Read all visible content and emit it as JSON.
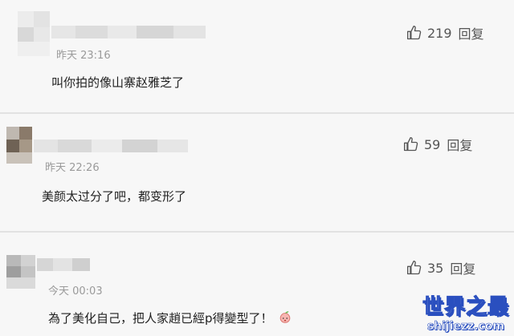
{
  "comments": [
    {
      "time": "昨天 23:16",
      "text": "叫你拍的像山寨赵雅芝了",
      "likes": "219",
      "reply_label": "回复"
    },
    {
      "time": "昨天 22:26",
      "text": "美颜太过分了吧，都变形了",
      "likes": "59",
      "reply_label": "回复"
    },
    {
      "time": "今天 00:03",
      "text": "為了美化自己，把人家趙已經p得變型了！",
      "likes": "35",
      "reply_label": "回复"
    }
  ],
  "icons": {
    "like": "thumbs-up-icon",
    "emoji": "peach-face-emoji"
  },
  "watermark": {
    "title": "世界之最",
    "url": "shijiezz.com"
  },
  "colors": {
    "background": "#f7f7f7",
    "separator": "#e2e2e2",
    "meta_text": "#9a9a9a",
    "watermark_blue": "#2a4fbf"
  }
}
